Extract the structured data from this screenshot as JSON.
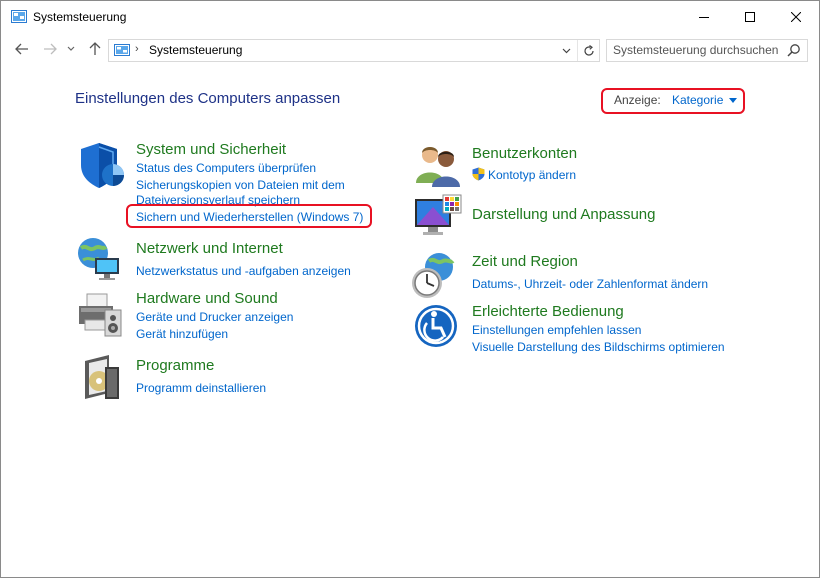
{
  "window": {
    "title": "Systemsteuerung"
  },
  "nav": {
    "breadcrumb_separator": "›",
    "address": "Systemsteuerung",
    "search_placeholder": "Systemsteuerung durchsuchen"
  },
  "main": {
    "heading": "Einstellungen des Computers anpassen",
    "view_label": "Anzeige:",
    "view_value": "Kategorie"
  },
  "categories_left": [
    {
      "title": "System und Sicherheit",
      "icon": "shield-security-icon",
      "links": [
        "Status des Computers überprüfen",
        "Sicherungskopien von Dateien mit dem",
        "Dateiversionsverlauf speichern",
        "Sichern und Wiederherstellen (Windows 7)"
      ]
    },
    {
      "title": "Netzwerk und Internet",
      "icon": "network-globe-icon",
      "links": [
        "Netzwerkstatus und -aufgaben anzeigen"
      ]
    },
    {
      "title": "Hardware und Sound",
      "icon": "printer-speaker-icon",
      "links": [
        "Geräte und Drucker anzeigen",
        "Gerät hinzufügen"
      ]
    },
    {
      "title": "Programme",
      "icon": "programs-disc-icon",
      "links": [
        "Programm deinstallieren"
      ]
    }
  ],
  "categories_right": [
    {
      "title": "Benutzerkonten",
      "icon": "user-accounts-icon",
      "links": [
        "Kontotyp ändern"
      ]
    },
    {
      "title": "Darstellung und Anpassung",
      "icon": "display-personalization-icon",
      "links": []
    },
    {
      "title": "Zeit und Region",
      "icon": "clock-globe-icon",
      "links": [
        "Datums-, Uhrzeit- oder Zahlenformat ändern"
      ]
    },
    {
      "title": "Erleichterte Bedienung",
      "icon": "ease-of-access-icon",
      "links": [
        "Einstellungen empfehlen lassen",
        "Visuelle Darstellung des Bildschirms optimieren"
      ]
    }
  ],
  "colors": {
    "heading": "#1e3287",
    "category_title": "#1f7a1f",
    "link": "#0066cc",
    "highlight": "#e81123"
  }
}
